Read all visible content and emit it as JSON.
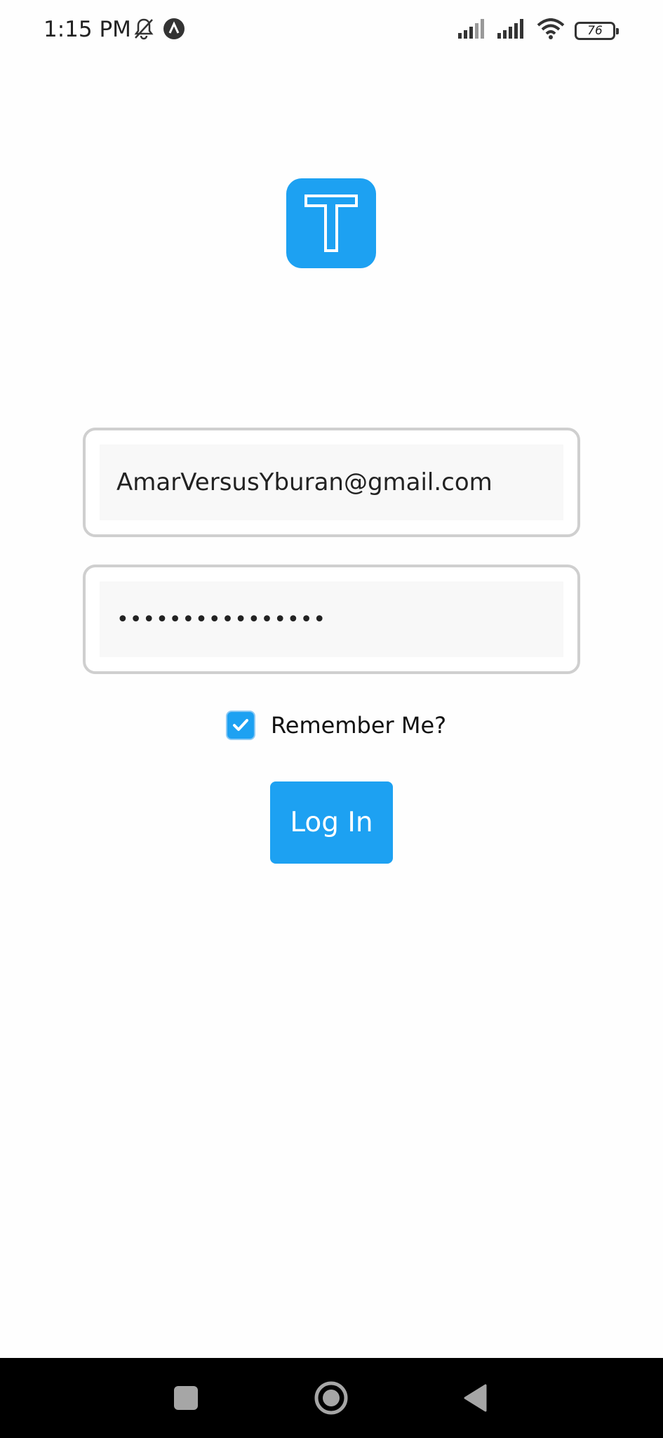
{
  "status_bar": {
    "time": "1:15 PM",
    "icons": [
      "bell-off-icon",
      "app-notification-icon",
      "signal-icon",
      "signal-icon",
      "wifi-icon",
      "battery-icon"
    ],
    "battery_level": "76"
  },
  "app": {
    "logo_letter": "T",
    "accent_color": "#1da1f2"
  },
  "login": {
    "email_value": "AmarVersusYburan@gmail.com",
    "password_value": "••••••••••••••••",
    "remember_label": "Remember Me?",
    "remember_checked": true,
    "login_button_label": "Log In"
  },
  "nav_bar": {
    "buttons": [
      "recents-button",
      "home-button",
      "back-button"
    ]
  }
}
